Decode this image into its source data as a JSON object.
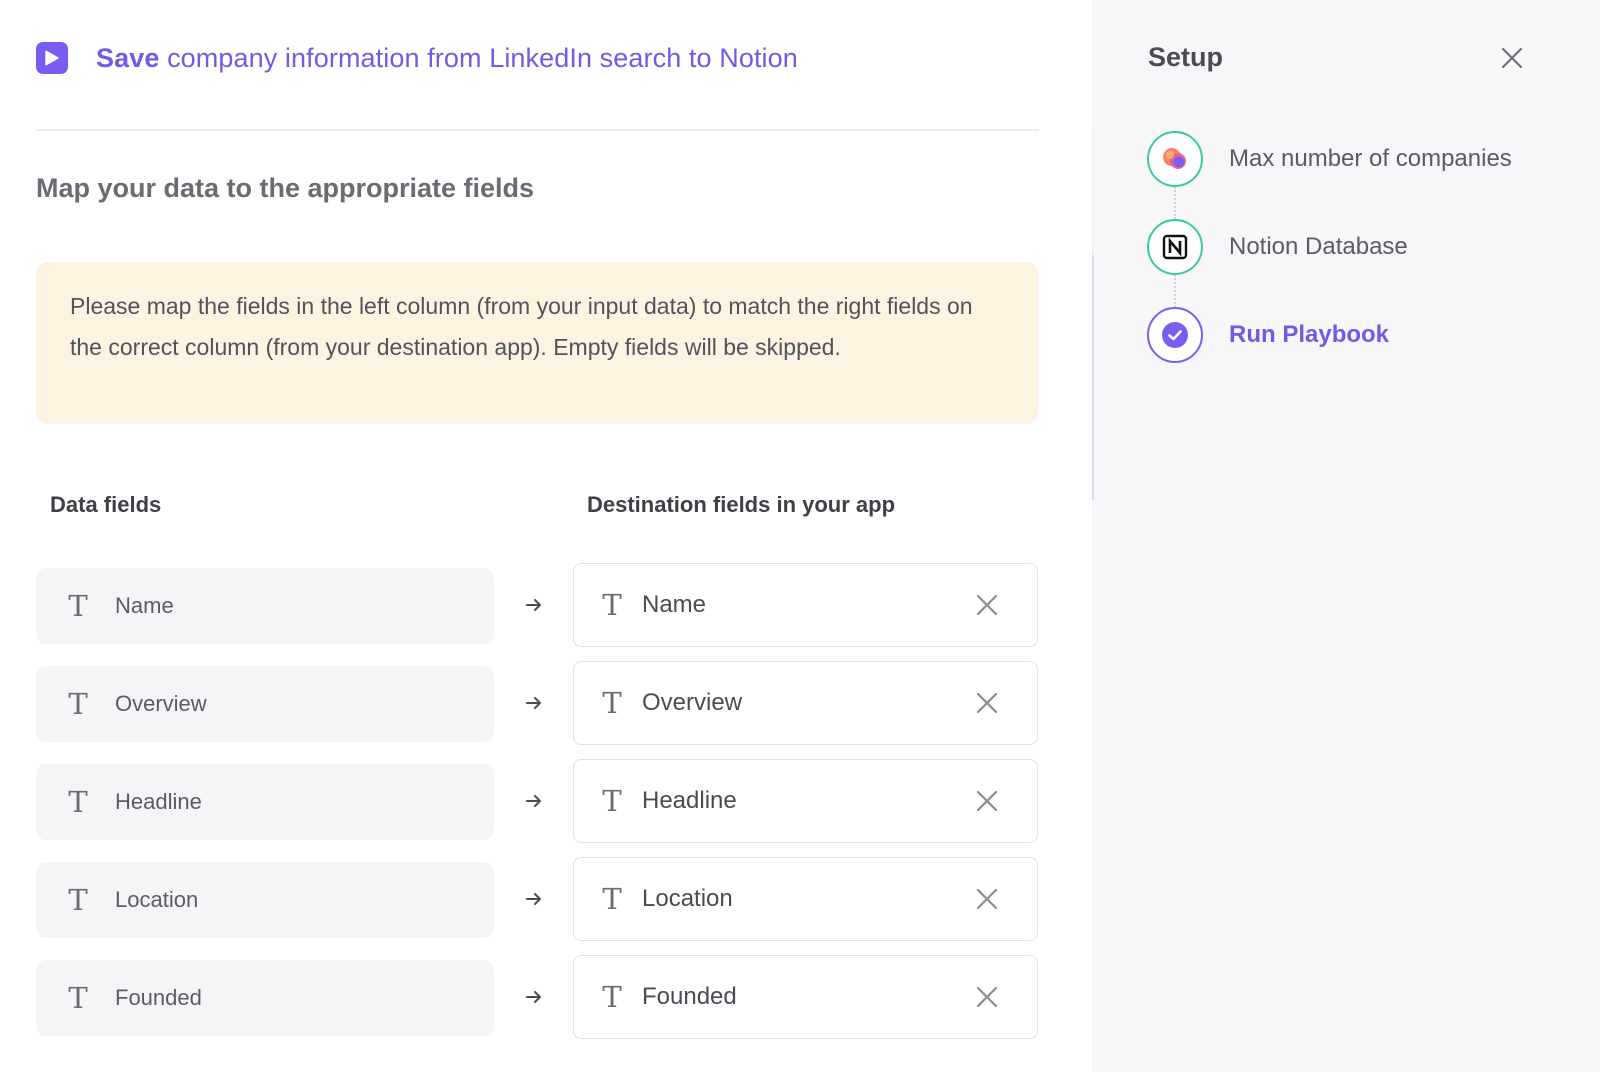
{
  "header": {
    "title_strong": "Save",
    "title_rest": "company information from LinkedIn search to Notion"
  },
  "main": {
    "section_title": "Map your data to the appropriate fields",
    "notice": "Please map the fields in the left column (from your input data) to match the right fields on the correct column (from your destination app). Empty fields will be skipped.",
    "columns": {
      "data_fields": "Data fields",
      "destination_fields": "Destination fields in your app"
    },
    "field_type_glyph": "T",
    "mappings": [
      {
        "source": "Name",
        "destination": "Name"
      },
      {
        "source": "Overview",
        "destination": "Overview"
      },
      {
        "source": "Headline",
        "destination": "Headline"
      },
      {
        "source": "Location",
        "destination": "Location"
      },
      {
        "source": "Founded",
        "destination": "Founded"
      }
    ]
  },
  "setup": {
    "title": "Setup",
    "steps": [
      {
        "label": "Max number of companies",
        "icon": "integration-logo-icon",
        "state": "done"
      },
      {
        "label": "Notion Database",
        "icon": "notion-icon",
        "state": "done"
      },
      {
        "label": "Run Playbook",
        "icon": "check-circle-icon",
        "state": "active"
      }
    ]
  },
  "colors": {
    "accent": "#7c5cf0",
    "accent_text": "#7359e6",
    "done_ring": "#3fc8a0",
    "notice_bg": "#fcf4e0",
    "sidebar_bg": "#f7f7f9"
  }
}
